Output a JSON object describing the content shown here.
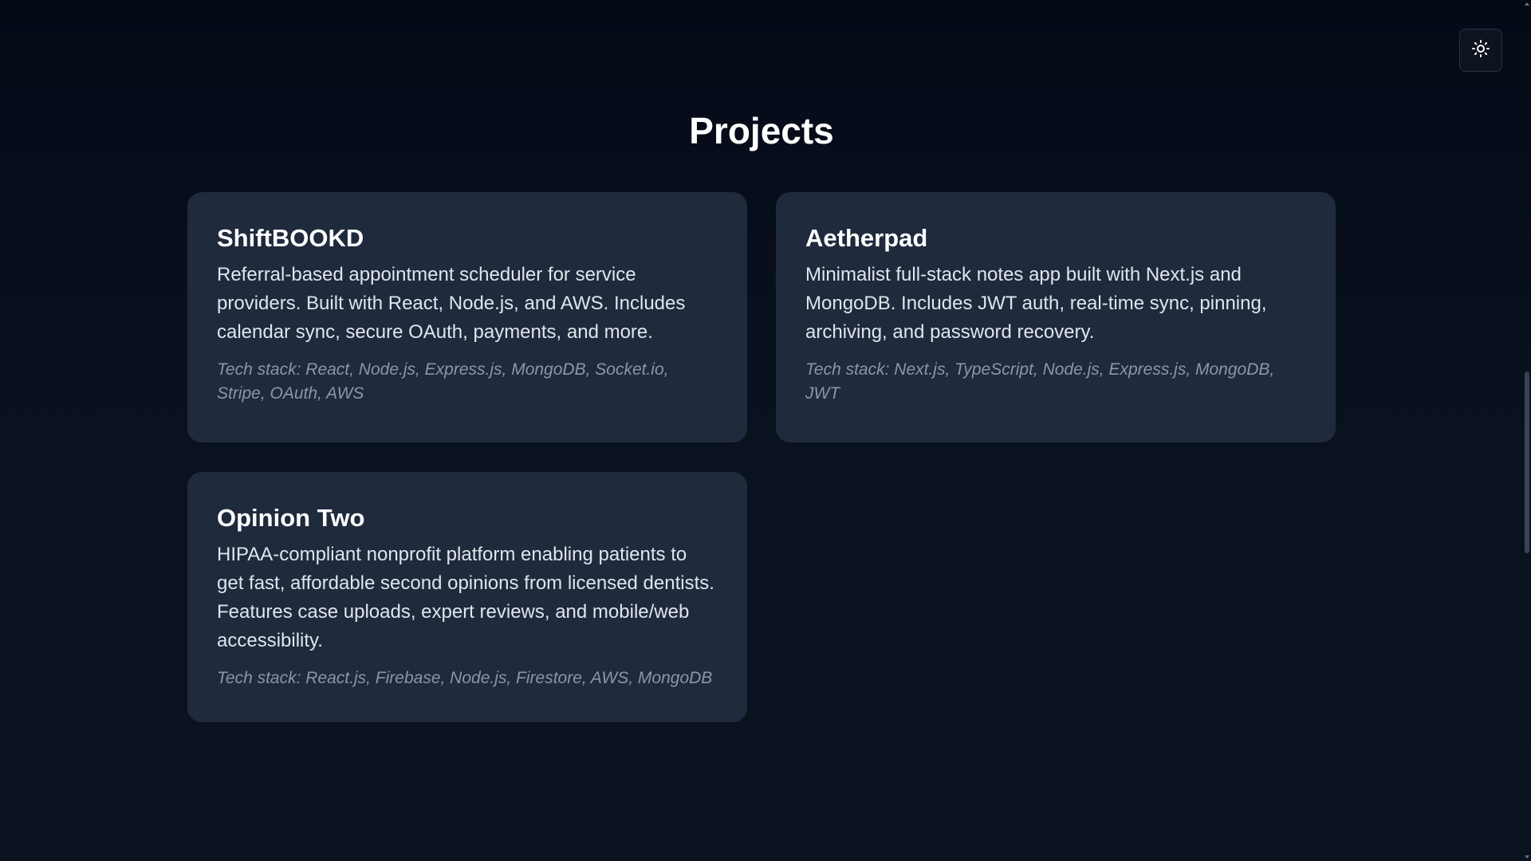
{
  "theme_toggle": {
    "icon": "sun-icon"
  },
  "section": {
    "title": "Projects"
  },
  "projects": [
    {
      "title": "ShiftBOOKD",
      "description": "Referral-based appointment scheduler for service providers. Built with React, Node.js, and AWS. Includes calendar sync, secure OAuth, payments, and more.",
      "tech_stack": "Tech stack: React, Node.js, Express.js, MongoDB, Socket.io, Stripe, OAuth, AWS"
    },
    {
      "title": "Aetherpad",
      "description": "Minimalist full-stack notes app built with Next.js and MongoDB. Includes JWT auth, real-time sync, pinning, archiving, and password recovery.",
      "tech_stack": "Tech stack: Next.js, TypeScript, Node.js, Express.js, MongoDB, JWT"
    },
    {
      "title": "Opinion Two",
      "description": "HIPAA-compliant nonprofit platform enabling patients to get fast, affordable second opinions from licensed dentists. Features case uploads, expert reviews, and mobile/web accessibility.",
      "tech_stack": "Tech stack: React.js, Firebase, Node.js, Firestore, AWS, MongoDB"
    }
  ],
  "colors": {
    "background": "#060b18",
    "card": "#1f2a3c",
    "title": "#ffffff",
    "description": "#dfe5ee",
    "tech_stack": "#8b97a9"
  }
}
